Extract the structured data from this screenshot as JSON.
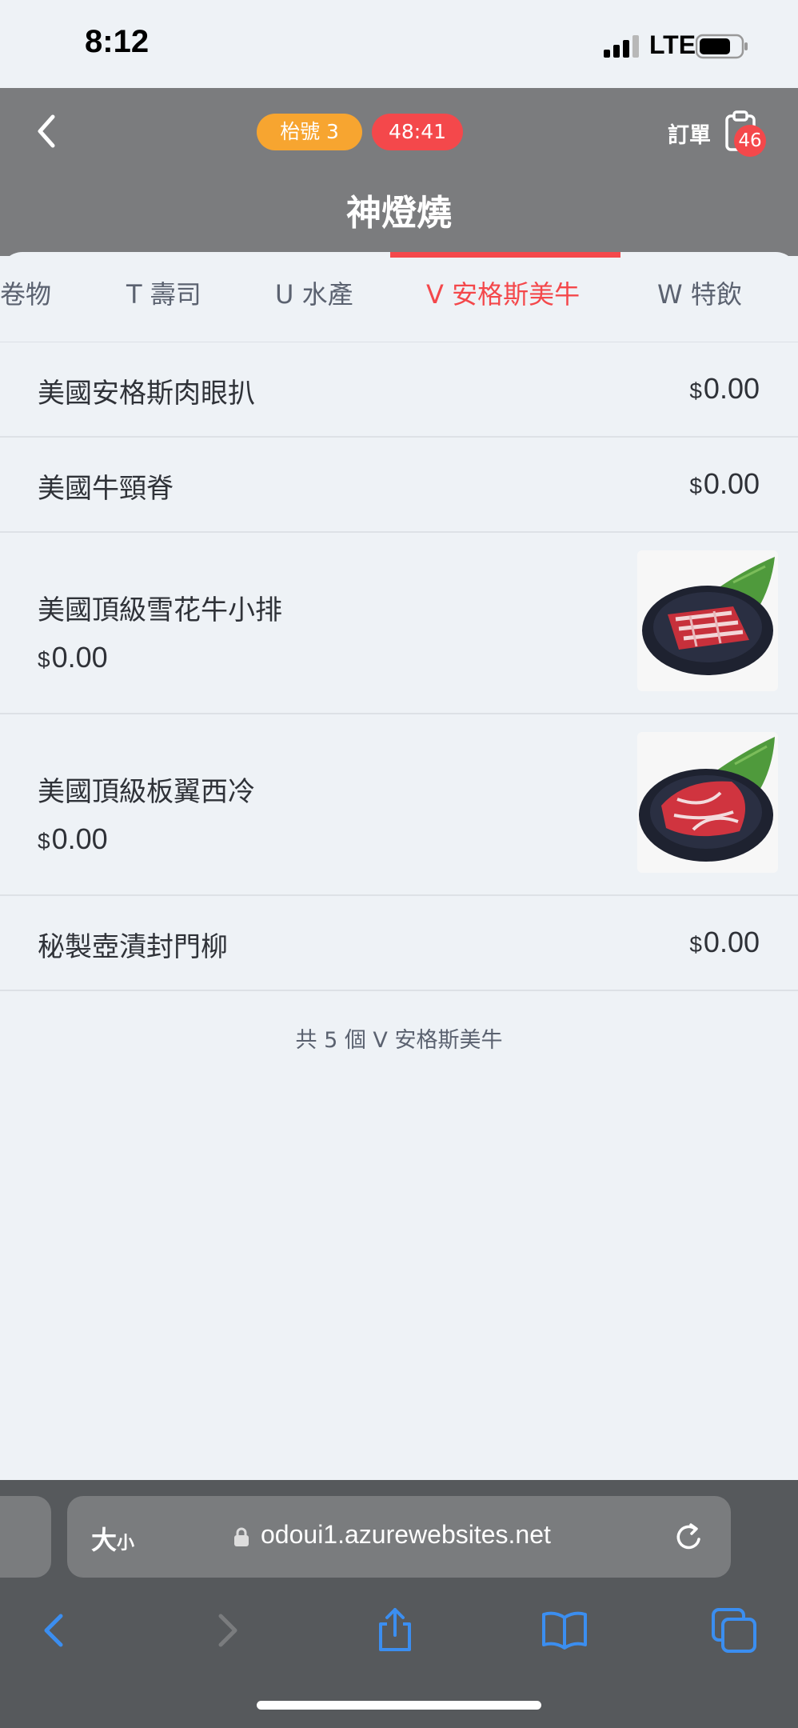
{
  "status_bar": {
    "time": "8:12",
    "carrier": "LTE"
  },
  "header": {
    "table_badge": "枱號 3",
    "timer": "48:41",
    "order_label": "訂單",
    "order_count": "46",
    "store_name": "神燈燒"
  },
  "tabs": [
    {
      "label": "卷物"
    },
    {
      "label": "T 壽司"
    },
    {
      "label": "U 水產"
    },
    {
      "label": "V 安格斯美牛",
      "active": true
    },
    {
      "label": "W 特飲"
    }
  ],
  "items": [
    {
      "name": "美國安格斯肉眼扒",
      "currency": "$",
      "price": "0.00"
    },
    {
      "name": "美國牛頸脊",
      "currency": "$",
      "price": "0.00"
    },
    {
      "name": "美國頂級雪花牛小排",
      "currency": "$",
      "price": "0.00",
      "image": "marbled-beef-plate"
    },
    {
      "name": "美國頂級板翼西冷",
      "currency": "$",
      "price": "0.00",
      "image": "sirloin-beef-plate"
    },
    {
      "name": "秘製壺漬封門柳",
      "currency": "$",
      "price": "0.00"
    }
  ],
  "list_footer": "共 5 個 V 安格斯美牛",
  "browser": {
    "text_size_big": "大",
    "text_size_small": "小",
    "url": "odoui1.azurewebsites.net"
  },
  "colors": {
    "accent_red": "#f4484b",
    "table_badge_orange": "#f7a530",
    "header_gray": "#7b7c7e",
    "page_bg": "#eef2f6",
    "browser_icon_blue": "#3b8ef0"
  },
  "icons": {
    "back": "chevron-left-icon",
    "order": "clipboard-icon",
    "lock": "lock-icon",
    "reload": "reload-icon",
    "browser_nav": [
      "back-arrow-icon",
      "forward-arrow-icon",
      "share-icon",
      "bookmarks-icon",
      "tabs-icon"
    ]
  }
}
